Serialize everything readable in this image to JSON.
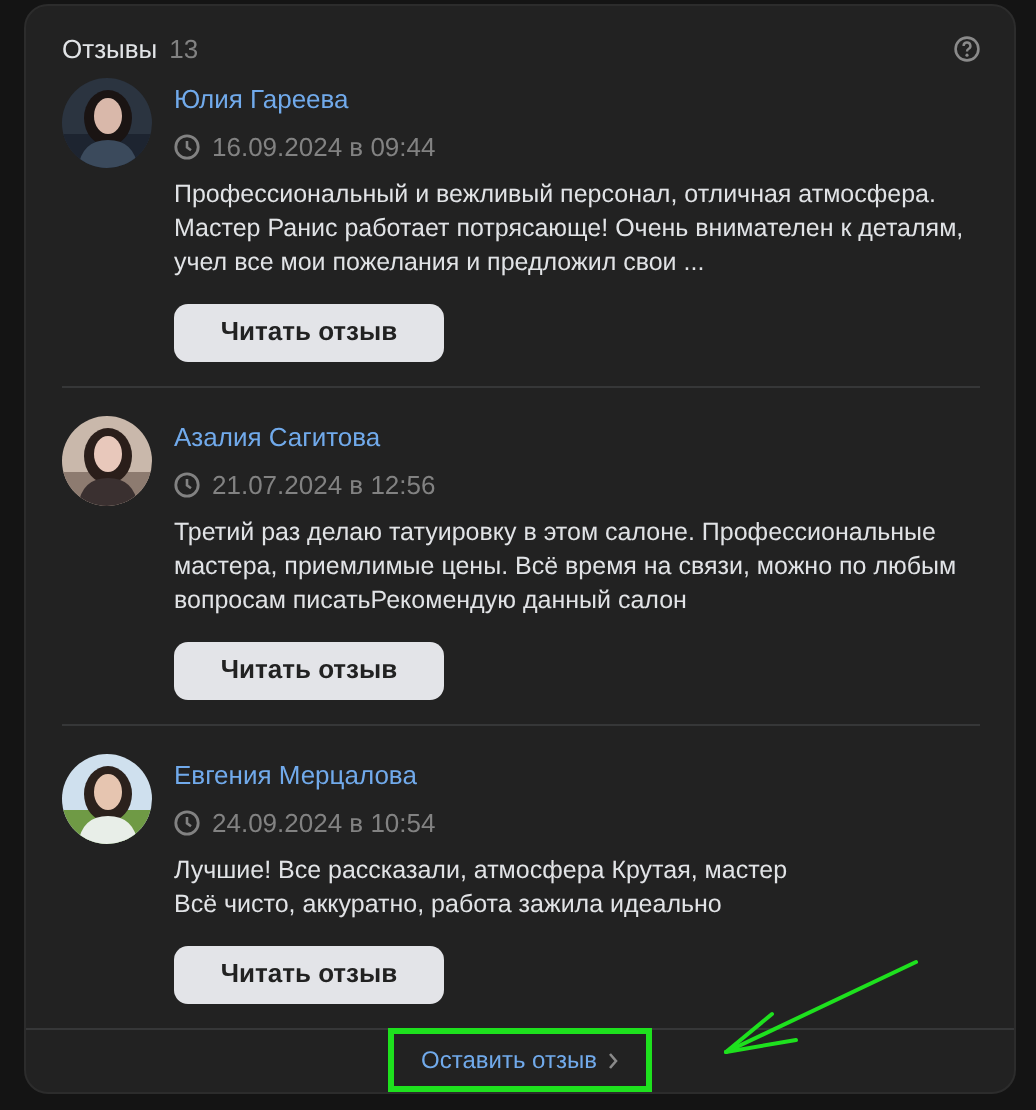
{
  "header": {
    "title": "Отзывы",
    "count": "13"
  },
  "reviews": [
    {
      "author": "Юлия Гареева",
      "date": "16.09.2024 в 09:44",
      "text": "Профессиональный и вежливый персонал, отличная атмосфера. Мастер Ранис работает потрясающе! Очень внимателен к деталям, учел все мои пожелания и предложил свои ...",
      "button": "Читать отзыв"
    },
    {
      "author": "Азалия Сагитова",
      "date": "21.07.2024 в 12:56",
      "text": "Третий раз делаю татуировку в этом салоне. Профессиональные мастера, приемлимые цены. Всё время на связи, можно по любым вопросам писатьРекомендую данный салон",
      "button": "Читать отзыв"
    },
    {
      "author": "Евгения Мерцалова",
      "date": "24.09.2024 в 10:54",
      "text": "Лучшие! Все рассказали, атмосфера Крутая, мастер\nВсё чисто, аккуратно, работа зажила идеально",
      "button": "Читать отзыв"
    }
  ],
  "footer": {
    "link": "Оставить отзыв",
    "highlighted": true
  }
}
